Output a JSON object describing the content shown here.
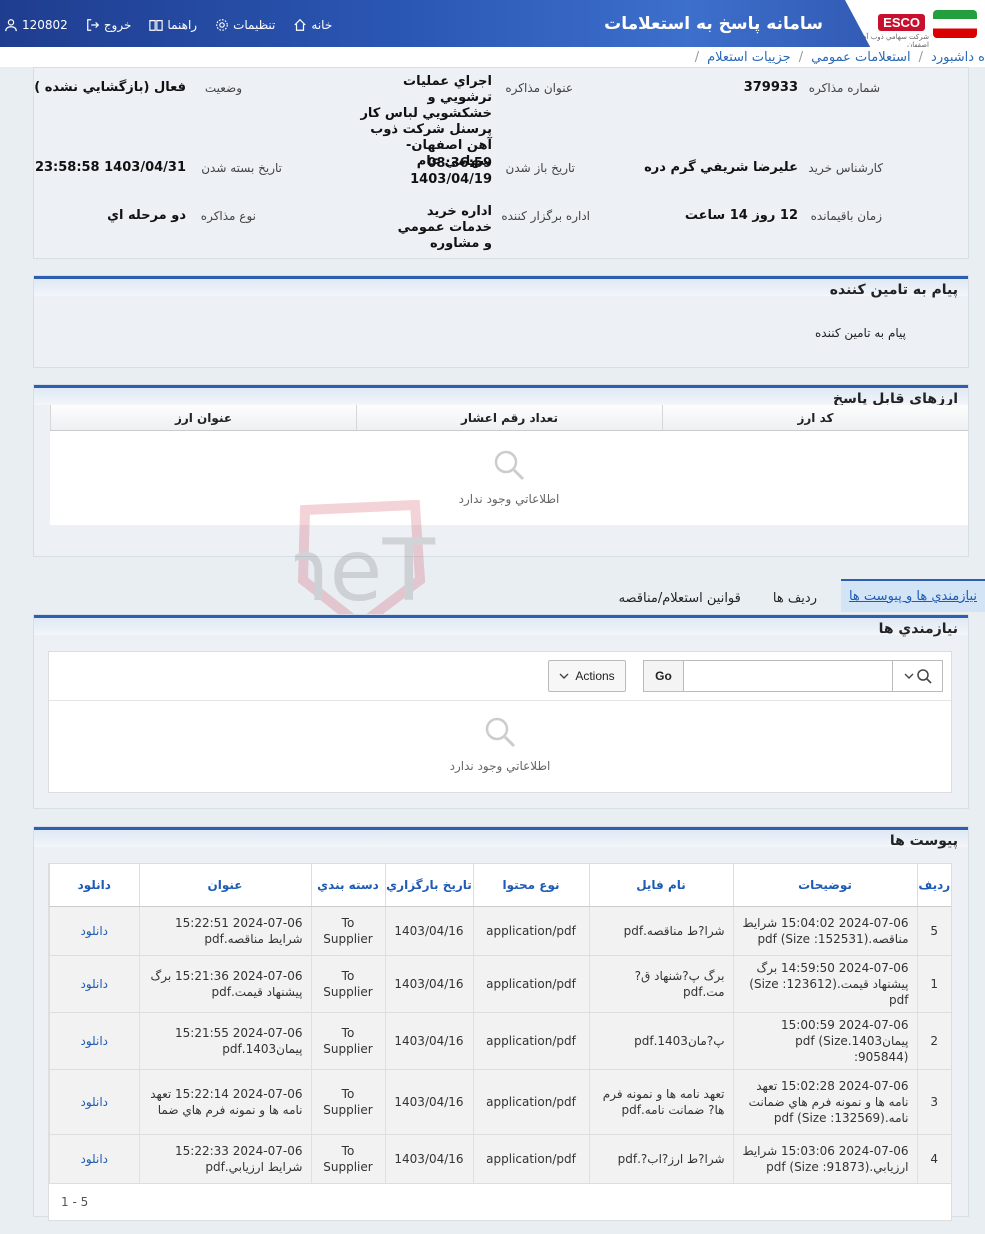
{
  "header": {
    "app_title": "سامانه پاسخ به استعلامات",
    "logo_esco": "ESCO",
    "logo_sub": "شرکت سهامي ذوب آهن اصفهان",
    "nav": {
      "home": "خانه",
      "settings": "تنظيمات",
      "guide": "راهنما",
      "logout": "خروج",
      "user_id": "120802"
    }
  },
  "breadcrumb": [
    "ه داشبورد",
    "استعلامات عمومي",
    "جزييات استعلام"
  ],
  "info": {
    "number_label": "شماره مذاکره",
    "number_value": "379933",
    "title_label": "عنوان مذاکره",
    "title_value": "اجراي عمليات ترشويي و خشکشويي لباس کار پرسنل شرکت ذوب آهن اصفهان- سهامي عام",
    "status_label": "وضعيت",
    "status_value": "فعال (بازگشايي نشده )",
    "buyer_label": "کارشناس خريد",
    "buyer_value": "عليرضا شريفي گرم دره",
    "open_label": "تاريخ باز شدن",
    "open_value": "08:36:59 1403/04/19",
    "close_label": "تاريخ بسته شدن",
    "close_value": "1403/04/31 23:58:58",
    "remaining_label": "زمان باقيمانده",
    "remaining_value": "12 روز 14 ساعت",
    "dept_label": "اداره برگزار کننده",
    "dept_value": "اداره خريد خدمات عمومي و مشاوره",
    "type_label": "نوع مذاکره",
    "type_value": "دو مرحله اي"
  },
  "supplier_msg": {
    "title": "پيام به تامين کننده",
    "body": "پيام به تامين کننده"
  },
  "currencies": {
    "title": "ارزهاي قابل پاسخ",
    "columns": [
      "کد ارز",
      "تعداد رقم اعشار",
      "عنوان ارز"
    ],
    "empty": "اطلاعاتي وجود ندارد"
  },
  "tabs": [
    "نيازمندي ها و پيوست ها",
    "رديف ها",
    "قوانين استعلام/مناقصه"
  ],
  "needs": {
    "title": "نيازمندي ها",
    "go": "Go",
    "actions": "Actions",
    "empty": "اطلاعاتي وجود ندارد"
  },
  "attachments": {
    "title": "پيوست ها",
    "columns": [
      "رديف",
      "توضيحات",
      "نام فايل",
      "نوع محتوا",
      "تاريخ بارگزاري",
      "دسته بندي",
      "عنوان",
      "دانلود"
    ],
    "rows": [
      {
        "row": "5",
        "desc": "2024-07-06 15:04:02 شرايط مناقصه.(Size :152531) pdf",
        "file": "شرا?ط مناقصه.pdf",
        "type": "application/pdf",
        "date": "1403/04/16",
        "cat": "To Supplier",
        "title": "2024-07-06 15:22:51 شرايط مناقصه.pdf",
        "dl": "دانلود"
      },
      {
        "row": "1",
        "desc": "2024-07-06 14:59:50 برگ پيشنهاد قيمت.(Size :123612) pdf",
        "file": "برگ پ?شنهاد ق?مت.pdf",
        "type": "application/pdf",
        "date": "1403/04/16",
        "cat": "To Supplier",
        "title": "2024-07-06 15:21:36 برگ پيشنهاد قيمت.pdf",
        "dl": "دانلود"
      },
      {
        "row": "2",
        "desc": "2024-07-06 15:00:59 پيمان1403.pdf (Size :905844)",
        "file": "پ?مان1403.pdf",
        "type": "application/pdf",
        "date": "1403/04/16",
        "cat": "To Supplier",
        "title": "2024-07-06 15:21:55 پيمان1403.pdf",
        "dl": "دانلود"
      },
      {
        "row": "3",
        "desc": "2024-07-06 15:02:28 تعهد نامه ها و نمونه فرم هاي ضمانت نامه.pdf (Size :132569)",
        "file": "تعهد نامه ها و نمونه فرم ها? ضمانت نامه.pdf",
        "type": "application/pdf",
        "date": "1403/04/16",
        "cat": "To Supplier",
        "title": "2024-07-06 15:22:14 تعهد نامه ها و نمونه فرم هاي ضما",
        "dl": "دانلود"
      },
      {
        "row": "4",
        "desc": "2024-07-06 15:03:06 شرايط ارزيابي.(Size :91873) pdf",
        "file": "شرا?ط ارز?اب?.pdf",
        "type": "application/pdf",
        "date": "1403/04/16",
        "cat": "To Supplier",
        "title": "2024-07-06 15:22:33 شرايط ارزيابي.pdf",
        "dl": "دانلود"
      }
    ],
    "pager": "1 - 5"
  },
  "watermark": "AriaTender.neT"
}
